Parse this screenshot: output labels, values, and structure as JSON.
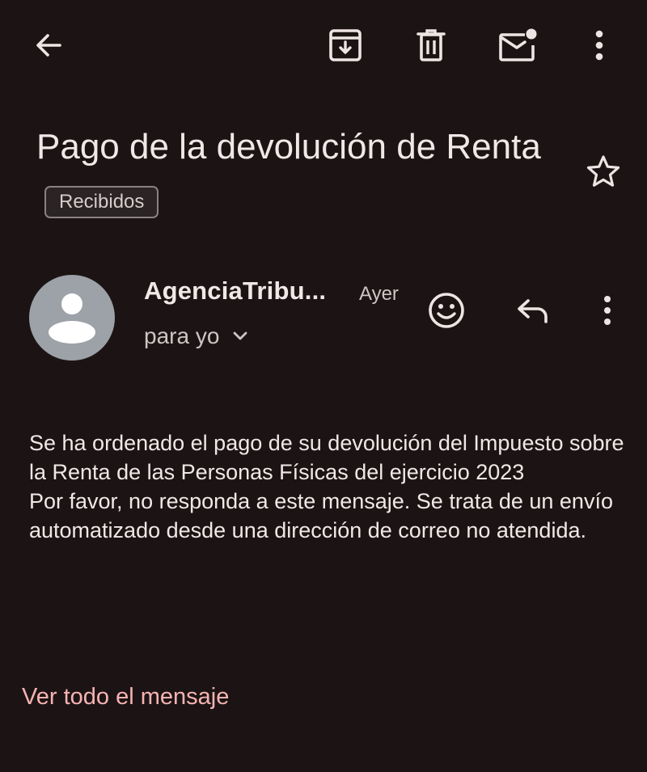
{
  "toolbar": {
    "back_icon": "arrow-back-icon",
    "archive_icon": "archive-icon",
    "delete_icon": "trash-icon",
    "mark_unread_icon": "mark-unread-icon",
    "more_icon": "more-vert-icon"
  },
  "email": {
    "subject": "Pago de la devolución de Renta",
    "label": "Recibidos",
    "starred": false,
    "sender": {
      "name": "AgenciaTribu...",
      "time": "Ayer",
      "recipient": "para yo",
      "avatar_icon": "person-icon"
    },
    "actions": {
      "react_icon": "emoji-icon",
      "reply_icon": "reply-icon",
      "more_icon": "more-vert-icon"
    },
    "body": {
      "paragraph_1": "Se ha ordenado el pago de su devolución del Impuesto sobre la Renta de las Personas Físicas del ejercicio 2023",
      "paragraph_2": "Por favor, no responda a este mensaje. Se trata de un envío automatizado desde una dirección de correo no atendida."
    },
    "view_full_link": "Ver todo el mensaje"
  },
  "colors": {
    "background": "#1c1414",
    "text": "#f2e7e7",
    "muted": "#cfc5c5",
    "link": "#f6b3b3",
    "avatar": "#9da1a8"
  }
}
